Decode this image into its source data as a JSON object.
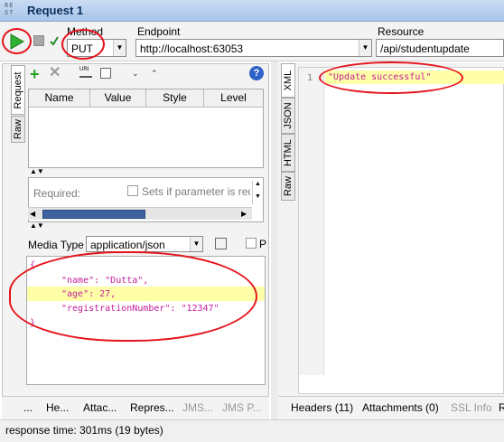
{
  "window": {
    "title": "Request 1",
    "logo": "RE\nST"
  },
  "toolbar": {
    "method_label": "Method",
    "method_value": "PUT",
    "endpoint_label": "Endpoint",
    "endpoint_value": "http://localhost:63053",
    "resource_label": "Resource",
    "resource_value": "/api/studentupdate"
  },
  "request": {
    "tabs": [
      "Request",
      "Raw"
    ],
    "param_columns": [
      "Name",
      "Value",
      "Style",
      "Level"
    ],
    "required_label": "Required:",
    "sets_if_label": "Sets if parameter is req",
    "media_type_label": "Media Type",
    "media_type_value": "application/json",
    "body_lines": [
      "{",
      "\"name\": \"Dutta\",",
      "\"age\": 27,",
      "\"registrationNumber\": \"12347\"",
      "}"
    ],
    "bottom_tabs": [
      "...",
      "He...",
      "Attac...",
      "Repres...",
      "JMS...",
      "JMS P..."
    ]
  },
  "response": {
    "tabs": [
      "XML",
      "JSON",
      "HTML",
      "Raw"
    ],
    "line_number": "1",
    "content": "\"Update successful\"",
    "bottom_tabs": [
      "Headers (11)",
      "Attachments (0)",
      "SSL Info",
      "R"
    ]
  },
  "status": {
    "text": "response time: 301ms (19 bytes)"
  },
  "colors": {
    "title_bar": "#a9c5ea",
    "annotation": "#e5131b",
    "highlight": "#ffffa8",
    "string": "#c21d9a"
  }
}
